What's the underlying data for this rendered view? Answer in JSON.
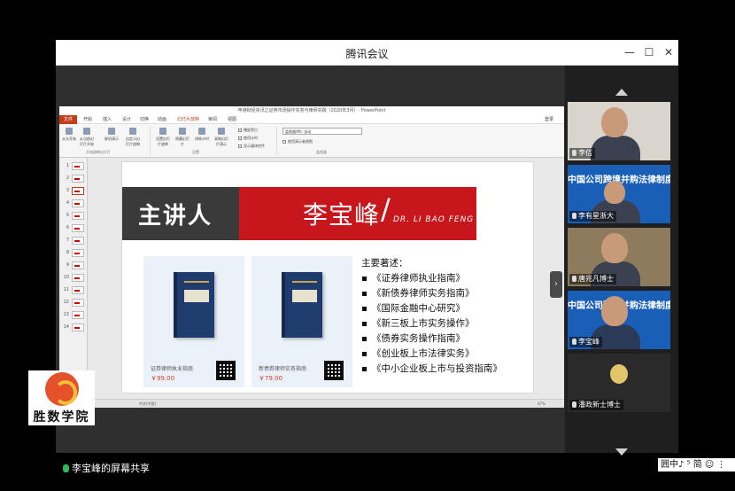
{
  "window": {
    "title": "腾讯会议",
    "controls": {
      "minimize": "—",
      "maximize": "☐",
      "close": "✕"
    }
  },
  "ppt": {
    "doc_title": "申港财经资讯之证券市场操作实务与律师实践（2020年3月）- PowerPoint",
    "file_tab": "文件",
    "tabs": [
      "开始",
      "插入",
      "设计",
      "切换",
      "动画",
      "幻灯片放映",
      "审阅",
      "视图"
    ],
    "active_tab": "幻灯片放映",
    "login": "登录",
    "ribbon": {
      "buttons": [
        "从头开始",
        "从当前幻灯片开始",
        "联机演示",
        "自定义幻灯片放映",
        "设置幻灯片放映",
        "隐藏幻灯片",
        "排练计时",
        "录制幻灯片演示"
      ],
      "groups": [
        "开始放映幻灯片",
        "设置",
        "监视器"
      ],
      "checks": [
        "播放旁白",
        "使用计时",
        "显示媒体控件",
        "使用演示者视图"
      ],
      "monitor_label": "监视器(M):",
      "monitor_value": "自动"
    },
    "thumbnails": [
      "1",
      "2",
      "3",
      "4",
      "5",
      "6",
      "7",
      "8",
      "9",
      "10",
      "11",
      "12",
      "13",
      "14"
    ],
    "active_thumb": 3,
    "status": {
      "slide_info": "幻灯片 3/30",
      "language": "中文(中国)",
      "zoom": "67%"
    }
  },
  "slide": {
    "banner_left": "主讲人",
    "banner_name": "李宝峰",
    "banner_slash": "/",
    "banner_eng": "DR. LI BAO FENG",
    "books": [
      {
        "name": "证券律师执业指南",
        "price": "￥99.00"
      },
      {
        "name": "新债券律师实务指南",
        "price": "￥79.00"
      }
    ],
    "works_heading": "主要著述：",
    "works": [
      "《证券律师执业指南》",
      "《新债券律师实务指南》",
      "《国际金融中心研究》",
      "《新三板上市实务操作》",
      "《债券实务操作指南》",
      "《创业板上市法律实务》",
      "《中小企业板上市与投资指南》"
    ]
  },
  "share_label": "李宝峰的屏幕共享",
  "participants": [
    {
      "name": "李佶",
      "style": "photo"
    },
    {
      "name": "李有星浙大",
      "style": "blue",
      "overlay": "中国公司跨境并购法律制度与实践"
    },
    {
      "name": "唐兆凡博士",
      "style": "photo"
    },
    {
      "name": "李宝峰",
      "style": "blue",
      "overlay": "中国公司跨境并购法律制度与实践"
    },
    {
      "name": "潘政新士博士",
      "style": "dark"
    }
  ],
  "logo_text": "胜数学院",
  "ime_bar": "囲中♪ ⁵ 简 ☺ ⋮",
  "colors": {
    "accent_red": "#c8161d",
    "meeting_blue": "#1a5fb7"
  }
}
